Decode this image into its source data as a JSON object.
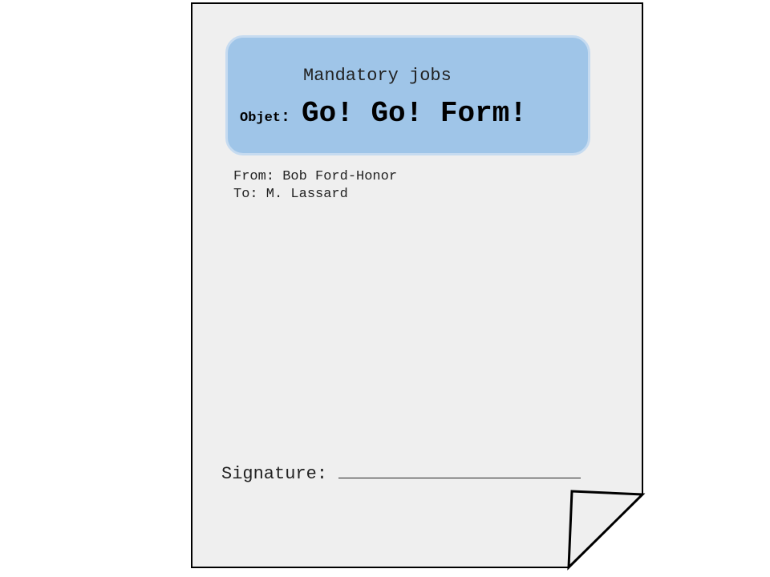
{
  "memo": {
    "title": "Mandatory jobs",
    "subject_label": "Objet",
    "subject_separator": ":",
    "subject": "Go! Go! Form!",
    "from_line": "From: Bob Ford-Honor",
    "to_line": "To: M. Lassard",
    "signature_label": "Signature:"
  },
  "colors": {
    "paper": "#efefef",
    "header_box": "#9fc5e8",
    "header_border": "#c6dbf0",
    "outline": "#000000"
  }
}
